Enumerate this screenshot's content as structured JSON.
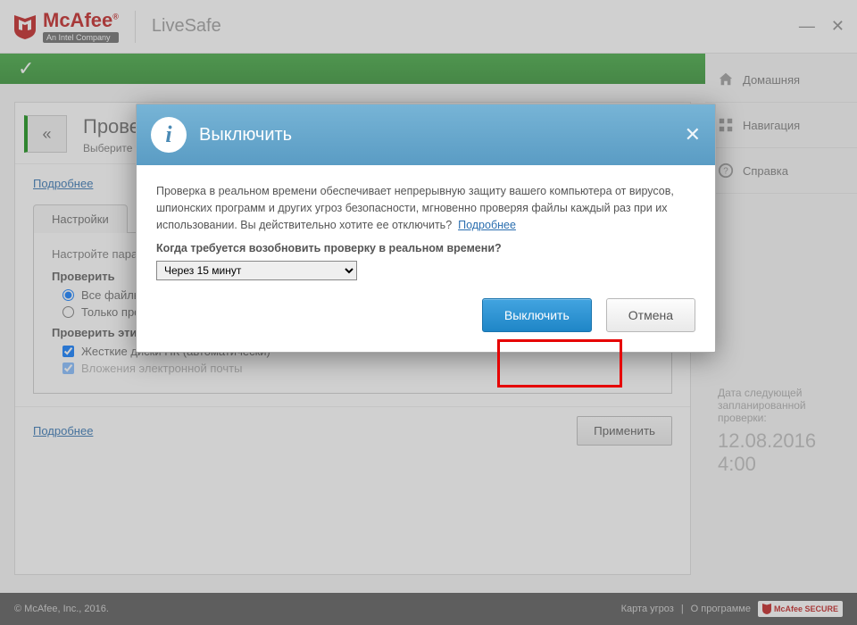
{
  "brand": {
    "name": "McAfee",
    "tagline": "An Intel Company",
    "product": "LiveSafe"
  },
  "sidebar": {
    "items": [
      {
        "label": "Домашняя"
      },
      {
        "label": "Навигация"
      },
      {
        "label": "Справка"
      }
    ],
    "next_scan_label": "Дата следующей запланированной проверки:",
    "next_scan_date": "12.08.2016",
    "next_scan_time": "4:00"
  },
  "panel": {
    "title": "Проверка в реальном времени: Выкл.",
    "subtitle": "Выберите тип проверки файлов и вложений электронной почты, а также угрозы, которые требуется выявлять.",
    "more": "Подробнее",
    "settings_tab": "Настройки",
    "settings_intro": "Настройте параметры проверки в реальном времени.",
    "group1_label": "Проверить",
    "opt1": "Все файлы (рекомендуется)",
    "opt2": "Только программы и документы",
    "group2_label": "Проверить эти вложения и расположения",
    "chk1": "Жесткие диски ПК (автоматически)",
    "chk2": "Вложения электронной почты",
    "apply": "Применить",
    "more2": "Подробнее"
  },
  "modal": {
    "title": "Выключить",
    "body": "Проверка в реальном времени обеспечивает непрерывную защиту вашего компьютера от вирусов, шпионских программ и других угроз безопасности, мгновенно проверяя файлы каждый раз при их использовании. Вы действительно хотите ее отключить?",
    "more": "Подробнее",
    "question": "Когда требуется возобновить проверку в реальном времени?",
    "select_value": "Через 15 минут",
    "confirm": "Выключить",
    "cancel": "Отмена"
  },
  "footer": {
    "copyright": "© McAfee, Inc., 2016.",
    "threat_map": "Карта угроз",
    "about": "О программе",
    "secure": "McAfee SECURE"
  }
}
